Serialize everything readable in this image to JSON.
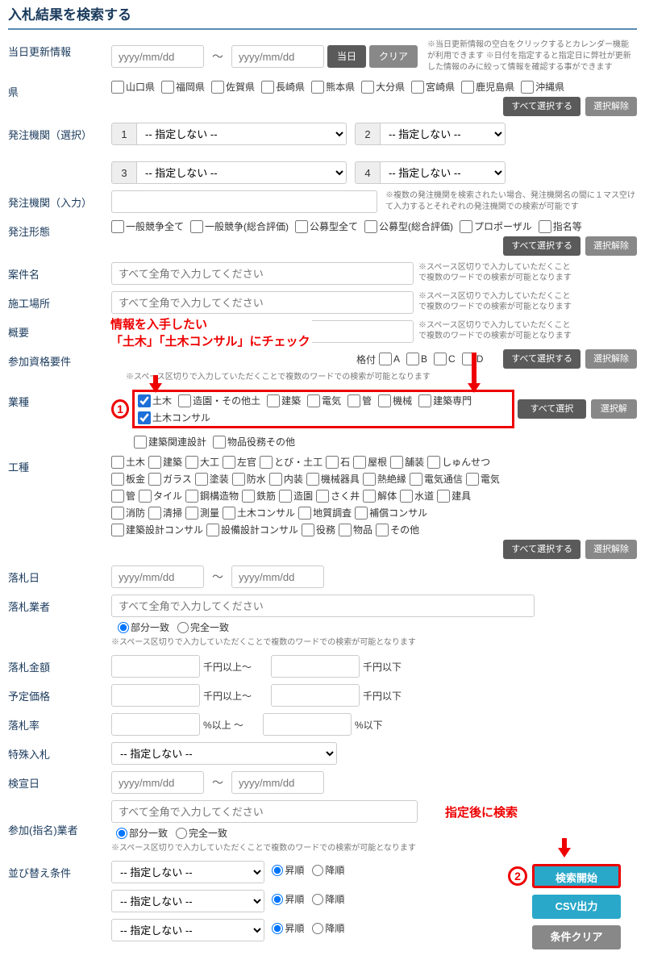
{
  "title": "入札結果を検索する",
  "row_labels": {
    "update": "当日更新情報",
    "pref": "県",
    "org_sel": "発注機関（選択）",
    "org_in": "発注機関（入力）",
    "form": "発注形態",
    "case": "案件名",
    "place": "施工場所",
    "summary": "概要",
    "qual": "参加資格要件",
    "industry": "業種",
    "worktype": "工種",
    "bid_date": "落札日",
    "bidder": "落札業者",
    "bid_amount": "落札金額",
    "est_price": "予定価格",
    "bid_rate": "落札率",
    "special": "特殊入札",
    "adv_date": "検宣日",
    "nominee": "参加(指名)業者",
    "sort": "並び替え条件"
  },
  "placeholders": {
    "date": "yyyy/mm/dd",
    "full_input": "すべて全角で入力してください"
  },
  "buttons": {
    "today": "当日",
    "clear": "クリア",
    "select_all": "すべて選択する",
    "deselect": "選択解除",
    "search": "検索開始",
    "csv": "CSV出力",
    "cond_clear": "条件クリア"
  },
  "notes": {
    "update": "※当日更新情報の空白をクリックするとカレンダー機能が利用できます\n※日付を指定すると指定日に弊社が更新した情報のみに絞って情報を確認する事ができます",
    "org_in": "※複数の発注機関を検索されたい場合、発注機関名の間に１マス空けて入力するとそれぞれの発注機関での検索が可能です",
    "space": "※スペース区切りで入力していただくことで複数のワードでの検索が可能となります",
    "space_inline": "※スペース区切りで入力していただくことで複数のワードでの検索が可能となります"
  },
  "prefs": [
    "山口県",
    "福岡県",
    "佐賀県",
    "長崎県",
    "熊本県",
    "大分県",
    "宮崎県",
    "鹿児島県",
    "沖縄県"
  ],
  "org_nums": [
    "1",
    "2",
    "3",
    "4"
  ],
  "org_opt": "-- 指定しない --",
  "form_types": [
    "一般競争全て",
    "一般競争(総合評価)",
    "公募型全て",
    "公募型(総合評価)",
    "プロポーザル",
    "指名等"
  ],
  "qual_label": "格付",
  "qual_grades": [
    "A",
    "B",
    "C",
    "D"
  ],
  "industries": [
    "土木",
    "造園・その他土",
    "建築",
    "電気",
    "管",
    "機械",
    "建築専門",
    "土木コンサル",
    "建築関連設計",
    "物品役務その他"
  ],
  "worktypes": [
    "土木",
    "建築",
    "大工",
    "左官",
    "とび・土工",
    "石",
    "屋根",
    "舗装",
    "しゅんせつ",
    "板金",
    "ガラス",
    "塗装",
    "防水",
    "内装",
    "機械器具",
    "熱絶縁",
    "電気通信",
    "電気",
    "管",
    "タイル",
    "鋼構造物",
    "鉄筋",
    "造園",
    "さく井",
    "解体",
    "水道",
    "建具",
    "消防",
    "清掃",
    "測量",
    "土木コンサル",
    "地質調査",
    "補償コンサル",
    "建築設計コンサル",
    "設備設計コンサル",
    "役務",
    "物品",
    "その他"
  ],
  "units": {
    "sen_ijou": "千円以上～",
    "sen_ika": "千円以下",
    "pct_ijou": "%以上 ～",
    "pct_ika": "%以下"
  },
  "sort_opt": "-- 指定しない --",
  "radio": {
    "asc": "昇順",
    "desc": "降順",
    "partial": "部分一致",
    "exact": "完全一致"
  },
  "annot": {
    "line1": "情報を入手したい",
    "line2": "「土木」「土木コンサル」にチェック",
    "act": "指定後に検索",
    "n1": "1",
    "n2": "2"
  }
}
